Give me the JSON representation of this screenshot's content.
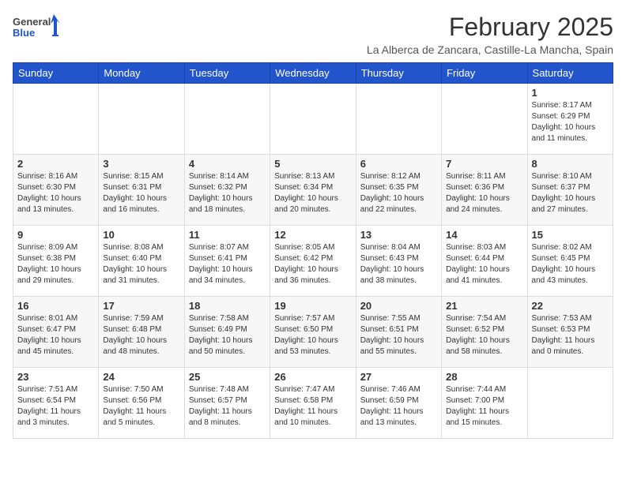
{
  "logo": {
    "general": "General",
    "blue": "Blue"
  },
  "title": "February 2025",
  "location": "La Alberca de Zancara, Castille-La Mancha, Spain",
  "days_of_week": [
    "Sunday",
    "Monday",
    "Tuesday",
    "Wednesday",
    "Thursday",
    "Friday",
    "Saturday"
  ],
  "weeks": [
    [
      {
        "day": "",
        "info": ""
      },
      {
        "day": "",
        "info": ""
      },
      {
        "day": "",
        "info": ""
      },
      {
        "day": "",
        "info": ""
      },
      {
        "day": "",
        "info": ""
      },
      {
        "day": "",
        "info": ""
      },
      {
        "day": "1",
        "info": "Sunrise: 8:17 AM\nSunset: 6:29 PM\nDaylight: 10 hours\nand 11 minutes."
      }
    ],
    [
      {
        "day": "2",
        "info": "Sunrise: 8:16 AM\nSunset: 6:30 PM\nDaylight: 10 hours\nand 13 minutes."
      },
      {
        "day": "3",
        "info": "Sunrise: 8:15 AM\nSunset: 6:31 PM\nDaylight: 10 hours\nand 16 minutes."
      },
      {
        "day": "4",
        "info": "Sunrise: 8:14 AM\nSunset: 6:32 PM\nDaylight: 10 hours\nand 18 minutes."
      },
      {
        "day": "5",
        "info": "Sunrise: 8:13 AM\nSunset: 6:34 PM\nDaylight: 10 hours\nand 20 minutes."
      },
      {
        "day": "6",
        "info": "Sunrise: 8:12 AM\nSunset: 6:35 PM\nDaylight: 10 hours\nand 22 minutes."
      },
      {
        "day": "7",
        "info": "Sunrise: 8:11 AM\nSunset: 6:36 PM\nDaylight: 10 hours\nand 24 minutes."
      },
      {
        "day": "8",
        "info": "Sunrise: 8:10 AM\nSunset: 6:37 PM\nDaylight: 10 hours\nand 27 minutes."
      }
    ],
    [
      {
        "day": "9",
        "info": "Sunrise: 8:09 AM\nSunset: 6:38 PM\nDaylight: 10 hours\nand 29 minutes."
      },
      {
        "day": "10",
        "info": "Sunrise: 8:08 AM\nSunset: 6:40 PM\nDaylight: 10 hours\nand 31 minutes."
      },
      {
        "day": "11",
        "info": "Sunrise: 8:07 AM\nSunset: 6:41 PM\nDaylight: 10 hours\nand 34 minutes."
      },
      {
        "day": "12",
        "info": "Sunrise: 8:05 AM\nSunset: 6:42 PM\nDaylight: 10 hours\nand 36 minutes."
      },
      {
        "day": "13",
        "info": "Sunrise: 8:04 AM\nSunset: 6:43 PM\nDaylight: 10 hours\nand 38 minutes."
      },
      {
        "day": "14",
        "info": "Sunrise: 8:03 AM\nSunset: 6:44 PM\nDaylight: 10 hours\nand 41 minutes."
      },
      {
        "day": "15",
        "info": "Sunrise: 8:02 AM\nSunset: 6:45 PM\nDaylight: 10 hours\nand 43 minutes."
      }
    ],
    [
      {
        "day": "16",
        "info": "Sunrise: 8:01 AM\nSunset: 6:47 PM\nDaylight: 10 hours\nand 45 minutes."
      },
      {
        "day": "17",
        "info": "Sunrise: 7:59 AM\nSunset: 6:48 PM\nDaylight: 10 hours\nand 48 minutes."
      },
      {
        "day": "18",
        "info": "Sunrise: 7:58 AM\nSunset: 6:49 PM\nDaylight: 10 hours\nand 50 minutes."
      },
      {
        "day": "19",
        "info": "Sunrise: 7:57 AM\nSunset: 6:50 PM\nDaylight: 10 hours\nand 53 minutes."
      },
      {
        "day": "20",
        "info": "Sunrise: 7:55 AM\nSunset: 6:51 PM\nDaylight: 10 hours\nand 55 minutes."
      },
      {
        "day": "21",
        "info": "Sunrise: 7:54 AM\nSunset: 6:52 PM\nDaylight: 10 hours\nand 58 minutes."
      },
      {
        "day": "22",
        "info": "Sunrise: 7:53 AM\nSunset: 6:53 PM\nDaylight: 11 hours\nand 0 minutes."
      }
    ],
    [
      {
        "day": "23",
        "info": "Sunrise: 7:51 AM\nSunset: 6:54 PM\nDaylight: 11 hours\nand 3 minutes."
      },
      {
        "day": "24",
        "info": "Sunrise: 7:50 AM\nSunset: 6:56 PM\nDaylight: 11 hours\nand 5 minutes."
      },
      {
        "day": "25",
        "info": "Sunrise: 7:48 AM\nSunset: 6:57 PM\nDaylight: 11 hours\nand 8 minutes."
      },
      {
        "day": "26",
        "info": "Sunrise: 7:47 AM\nSunset: 6:58 PM\nDaylight: 11 hours\nand 10 minutes."
      },
      {
        "day": "27",
        "info": "Sunrise: 7:46 AM\nSunset: 6:59 PM\nDaylight: 11 hours\nand 13 minutes."
      },
      {
        "day": "28",
        "info": "Sunrise: 7:44 AM\nSunset: 7:00 PM\nDaylight: 11 hours\nand 15 minutes."
      },
      {
        "day": "",
        "info": ""
      }
    ]
  ]
}
